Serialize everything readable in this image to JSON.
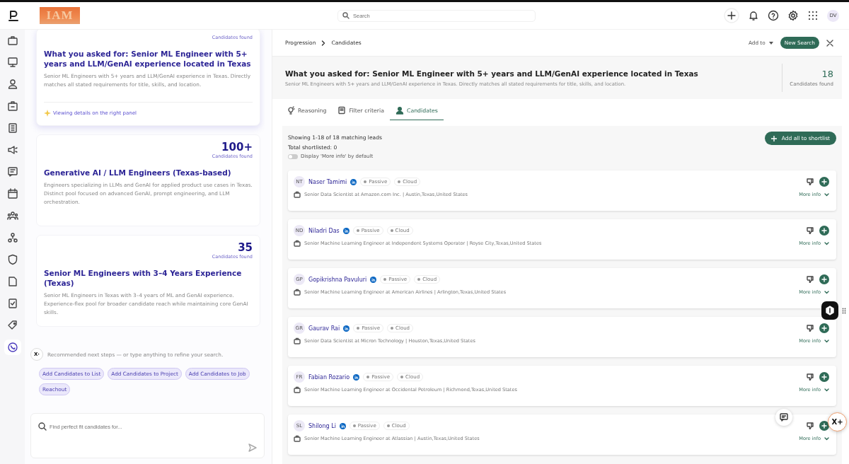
{
  "topbar": {
    "logo": "IAM",
    "search": {
      "placeholder": "Search"
    },
    "avatar": "DV"
  },
  "sidebar": {
    "items": [
      {
        "selected": false
      },
      {
        "selected": false
      },
      {
        "selected": false
      },
      {
        "selected": false
      },
      {
        "selected": false
      },
      {
        "selected": false
      },
      {
        "selected": false
      },
      {
        "selected": false
      },
      {
        "selected": false
      },
      {
        "selected": false
      },
      {
        "selected": false
      },
      {
        "selected": false
      },
      {
        "selected": false
      },
      {
        "selected": false
      },
      {
        "selected": true
      }
    ]
  },
  "suggestions": [
    {
      "count_label": "Candidates found",
      "title": "What you asked for: Senior ML Engineer with 5+ years and LLM/GenAI experience located in Texas",
      "description": "Senior ML Engineers with 5+ years and LLM/GenAI experience in Texas. Directly matches all stated requirements for title, skills, and location.",
      "selected": true,
      "note": "Viewing details on the right panel"
    },
    {
      "count": "100+",
      "count_label": "Candidates found",
      "title": "Generative AI / LLM Engineers (Texas-based)",
      "description": "Engineers specializing in LLMs and GenAI for applied product use cases in Texas. Distinct pool focused on advanced GenAI, prompt engineering, and LLM orchestration.",
      "selected": false
    },
    {
      "count": "35",
      "count_label": "Candidates found",
      "title": "Senior ML Engineers with 3–4 Years Experience (Texas)",
      "description": "Senior ML Engineers in Texas with 3–4 years of ML and GenAI experience. Experience-flex pool for broader candidate reach while maintaining core GenAI skills.",
      "selected": false
    }
  ],
  "assistant": {
    "avatar": "X·",
    "message": "Recommended next steps — or type anything to refine your search.",
    "chips": [
      "Add Candidates to List",
      "Add Candidates to Project",
      "Add Candidates to Job",
      "Reachout"
    ],
    "input": {
      "placeholder": "Find perfect fit candidates for..."
    }
  },
  "panel": {
    "breadcrumb": [
      "Progression",
      "Candidates"
    ],
    "add_to": "Add to",
    "new_search": "New Search",
    "title": "What you asked for: Senior ML Engineer with 5+ years and LLM/GenAI experience located in Texas",
    "description": "Senior ML Engineers with 5+ years and LLM/GenAI experience in Texas. Directly matches all stated requirements for title, skills, and location.",
    "count": "18",
    "count_label": "Candidates found",
    "tabs": [
      {
        "label": "Reasoning",
        "selected": false,
        "kind": "bulb"
      },
      {
        "label": "Filter criteria",
        "selected": false,
        "kind": "book"
      },
      {
        "label": "Candidates",
        "selected": true,
        "kind": "person"
      }
    ],
    "showing": "Showing 1-18 of 18 matching leads",
    "shortlisted": "Total shortlisted: 0",
    "toggle": {
      "label": "Display 'More info' by default",
      "on": false
    },
    "add_all": "Add all to shortlist",
    "candidates": [
      {
        "initials": "NT",
        "name": "Naser Tamimi",
        "tags": [
          "Passive",
          "Cloud"
        ],
        "detail": "Senior Data Scientist at Amazon.com Inc. | Austin,Texas,United States",
        "more": "More info"
      },
      {
        "initials": "ND",
        "name": "Niladri Das",
        "tags": [
          "Passive",
          "Cloud"
        ],
        "detail": "Senior Machine Learning Engineer at Independent Systems Operator | Royse City,Texas,United States",
        "more": "More info"
      },
      {
        "initials": "GP",
        "name": "Gopikrishna Pavuluri",
        "tags": [
          "Passive",
          "Cloud"
        ],
        "detail": "Senior Machine Learning Engineer at American Airlines | Arlington,Texas,United States",
        "more": "More info"
      },
      {
        "initials": "GR",
        "name": "Gaurav Rai",
        "tags": [
          "Passive",
          "Cloud"
        ],
        "detail": "Senior Data Scientist at Micron Technology | Houston,Texas,United States",
        "more": "More info"
      },
      {
        "initials": "FR",
        "name": "Fabian Rozario",
        "tags": [
          "Passive",
          "Cloud"
        ],
        "detail": "Senior Machine Learning Engineer at Occidental Petroleum | Richmond,Texas,United States",
        "more": "More info"
      },
      {
        "initials": "SL",
        "name": "Shilong Li",
        "tags": [
          "Passive",
          "Cloud"
        ],
        "detail": "Senior Machine Learning Engineer at Atlassian | Austin,Texas,United States",
        "more": "More info"
      }
    ]
  },
  "fab": {
    "label": "X+"
  }
}
